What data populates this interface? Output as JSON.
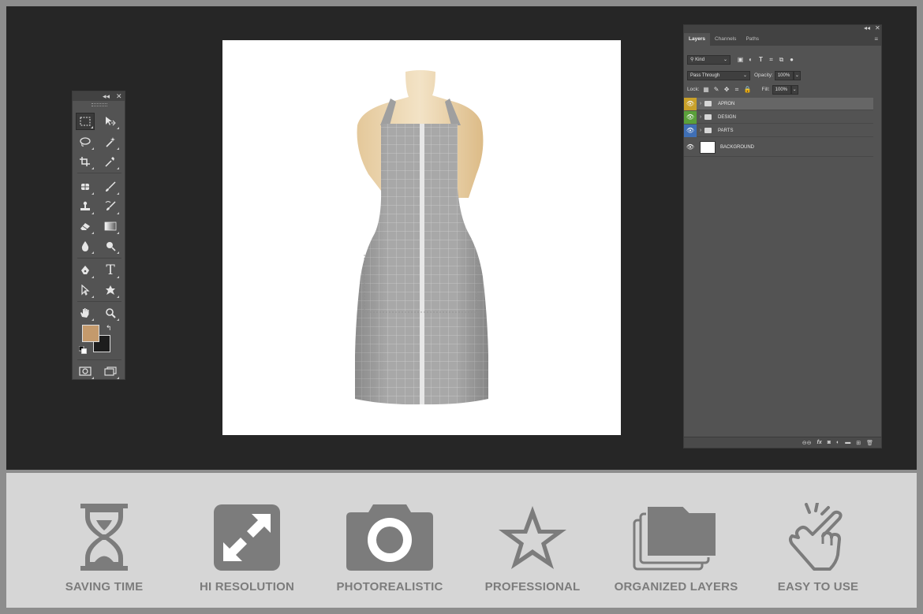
{
  "toolbox": {
    "collapse_glyph": "◂◂",
    "close_glyph": "✕",
    "foreground_color": "#c49a6c",
    "background_color": "#1d1d1d"
  },
  "canvas": {
    "background": "#ffffff",
    "content": "apron mockup on mannequin"
  },
  "layers_panel": {
    "collapse_glyph": "◂◂",
    "close_glyph": "✕",
    "tabs": [
      {
        "label": "Layers",
        "active": true
      },
      {
        "label": "Channels",
        "active": false
      },
      {
        "label": "Paths",
        "active": false
      }
    ],
    "filter_kind": "Kind",
    "blend_mode": "Pass Through",
    "opacity_label": "Opacity:",
    "opacity_value": "100%",
    "lock_label": "Lock:",
    "fill_label": "Fill:",
    "fill_value": "100%",
    "layers": [
      {
        "name": "APRON",
        "type": "group",
        "tag_color": "#c9a12a"
      },
      {
        "name": "DESIGN",
        "type": "group",
        "tag_color": "#5aa03a"
      },
      {
        "name": "PARTS",
        "type": "group",
        "tag_color": "#3f6fb5"
      },
      {
        "name": "BACKGROUND",
        "type": "layer",
        "tag_color": ""
      }
    ],
    "footer_icons": [
      "link-icon",
      "fx-icon",
      "mask-icon",
      "adjustment-icon",
      "folder-icon",
      "new-layer-icon",
      "trash-icon"
    ]
  },
  "features": [
    {
      "label": "SAVING TIME",
      "icon": "hourglass-icon"
    },
    {
      "label": "HI RESOLUTION",
      "icon": "expand-icon"
    },
    {
      "label": "PHOTOREALISTIC",
      "icon": "camera-icon"
    },
    {
      "label": "PROFESSIONAL",
      "icon": "star-icon"
    },
    {
      "label": "ORGANIZED LAYERS",
      "icon": "layers-folder-icon"
    },
    {
      "label": "EASY TO USE",
      "icon": "pointing-hand-icon"
    }
  ],
  "colors": {
    "feature_icon": "#7c7c7c",
    "workspace": "#262626",
    "banner": "#d6d6d6"
  }
}
